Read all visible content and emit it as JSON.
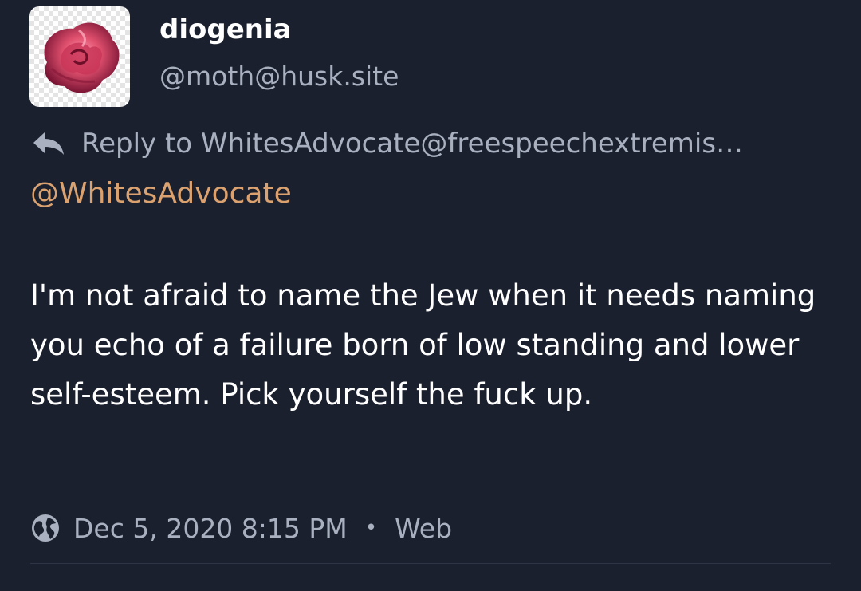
{
  "author": {
    "display_name": "diogenia",
    "handle": "@moth@husk.site",
    "avatar_icon": "rose-avatar"
  },
  "reply": {
    "icon": "reply-arrow-icon",
    "text": "Reply to WhitesAdvocate@freespeechextremis…"
  },
  "post": {
    "mention": "@WhitesAdvocate",
    "body": "I'm not afraid to name the Jew when it needs naming you echo of a failure born of low standing and lower self-esteem. Pick yourself the fuck up."
  },
  "meta": {
    "visibility_icon": "globe-icon",
    "timestamp": "Dec 5, 2020 8:15 PM",
    "separator": "•",
    "client": "Web"
  },
  "colors": {
    "background": "#1a202e",
    "text": "#ffffff",
    "muted": "#a9b1c0",
    "mention": "#dba270"
  }
}
